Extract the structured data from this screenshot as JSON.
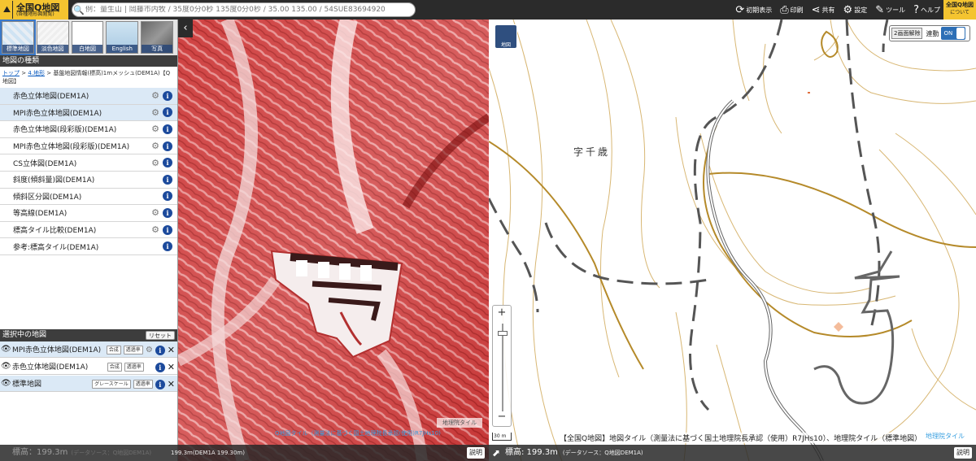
{
  "app": {
    "logo_title": "全国Q地図",
    "logo_sub": "(各種地形図閲覧)",
    "about_label": "全国Q地図",
    "about_sub": "について"
  },
  "search": {
    "placeholder": "例：量生山 | 岡藤市内牧 / 35度0分0秒 135度0分0秒 / 35.00 135.00 / 54SUE83694920"
  },
  "toolbar": {
    "items": [
      {
        "label": "初期表示",
        "icon": "reload-icon"
      },
      {
        "label": "印刷",
        "icon": "print-icon"
      },
      {
        "label": "共有",
        "icon": "share-icon"
      },
      {
        "label": "設定",
        "icon": "gear-icon"
      },
      {
        "label": "ツール",
        "icon": "wrench-icon"
      },
      {
        "label": "ヘルプ",
        "icon": "help-icon"
      }
    ]
  },
  "basemaps": [
    {
      "label": "標準地図",
      "selected": true
    },
    {
      "label": "淡色地図",
      "selected": false
    },
    {
      "label": "白地図",
      "selected": false
    },
    {
      "label": "English",
      "selected": false
    },
    {
      "label": "写真",
      "selected": false
    }
  ],
  "sidebar": {
    "section_title": "地図の種類",
    "breadcrumb": {
      "top": "トップ",
      "sep1": " > ",
      "category": "4.地形",
      "sep2": " > ",
      "current": "基盤地図情報(標高)1mメッシュ(DEM1A)【Q地図】"
    },
    "items": [
      {
        "label": "赤色立体地図(DEM1A)",
        "gear": true,
        "selected": true
      },
      {
        "label": "MPI赤色立体地図(DEM1A)",
        "gear": true,
        "selected": true
      },
      {
        "label": "赤色立体地図(段彩版)(DEM1A)",
        "gear": true,
        "selected": false
      },
      {
        "label": "MPI赤色立体地図(段彩版)(DEM1A)",
        "gear": true,
        "selected": false
      },
      {
        "label": "CS立体図(DEM1A)",
        "gear": true,
        "selected": false
      },
      {
        "label": "斜度(傾斜量)図(DEM1A)",
        "gear": false,
        "selected": false
      },
      {
        "label": "傾斜区分図(DEM1A)",
        "gear": false,
        "selected": false
      },
      {
        "label": "等高線(DEM1A)",
        "gear": true,
        "selected": false
      },
      {
        "label": "標高タイル比較(DEM1A)",
        "gear": true,
        "selected": false
      },
      {
        "label": "参考:標高タイル(DEM1A)",
        "gear": false,
        "selected": false
      }
    ]
  },
  "selected_maps": {
    "title": "選択中の地図",
    "reset_label": "リセット",
    "layers": [
      {
        "label": "MPI赤色立体地図(DEM1A)",
        "chips": [
          "合成",
          "透過率"
        ],
        "gear": true
      },
      {
        "label": "赤色立体地図(DEM1A)",
        "chips": [
          "合成",
          "透過率"
        ],
        "gear": false
      },
      {
        "label": "標準地図",
        "chips": [
          "グレースケール",
          "透過率"
        ],
        "gear": false
      }
    ]
  },
  "left_map": {
    "attribution": "地理院タイル",
    "credit": "Q地図タイル（測量法に基づく国土地理院長承認(使用)R7JHs10)",
    "elevation_label": "標高：199.3m",
    "elevation_src": "(データソース：Q地図DEM1A)",
    "elevation_src2": "199.3m(DEM1A 199.30m)",
    "explain_label": "説明"
  },
  "right_map": {
    "place_name": "字千歳",
    "two_pane_label": "2画面解除",
    "sync_label": "連動",
    "sync_state": "ON",
    "scale_label": "30 m",
    "credit": "【全国Q地図】地図タイル（測量法に基づく国土地理院長承認（使用）R7JHs10）、地理院タイル（標準地図）",
    "attribution": "地理院タイル",
    "elevation_label": "標高: 199.3m",
    "elevation_src": "(データソース：Q地図DEM1A)",
    "explain_label": "説明",
    "mini_label": "地図"
  },
  "colors": {
    "accent": "#f4c430",
    "toolbar_bg": "#2b2b2b",
    "relief_red": "#c42a2a",
    "contour": "#b58a2a",
    "info_blue": "#1c4a9c"
  }
}
